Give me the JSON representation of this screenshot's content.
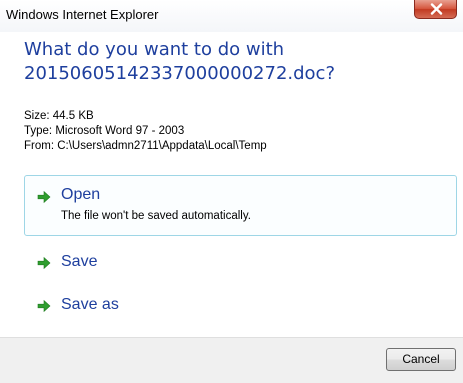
{
  "window": {
    "title": "Windows Internet Explorer"
  },
  "prompt": {
    "line1": "What do you want to do with",
    "filename": "20150605142337000000272.doc?"
  },
  "file_info": {
    "size": "Size: 44.5 KB",
    "type": "Type: Microsoft Word 97 - 2003",
    "from": "From: C:\\Users\\admn2711\\Appdata\\Local\\Temp"
  },
  "options": {
    "open": {
      "label": "Open",
      "description": "The file won't be saved automatically.",
      "icon": "green-arrow-icon"
    },
    "save": {
      "label": "Save",
      "icon": "green-arrow-icon"
    },
    "save_as": {
      "label": "Save as",
      "icon": "green-arrow-icon"
    }
  },
  "footer": {
    "cancel_label": "Cancel"
  },
  "colors": {
    "heading": "#1e3f9e",
    "arrow": "#2f9e2f",
    "selected_border": "#9ed6e6",
    "close_button": "#c74b32"
  }
}
